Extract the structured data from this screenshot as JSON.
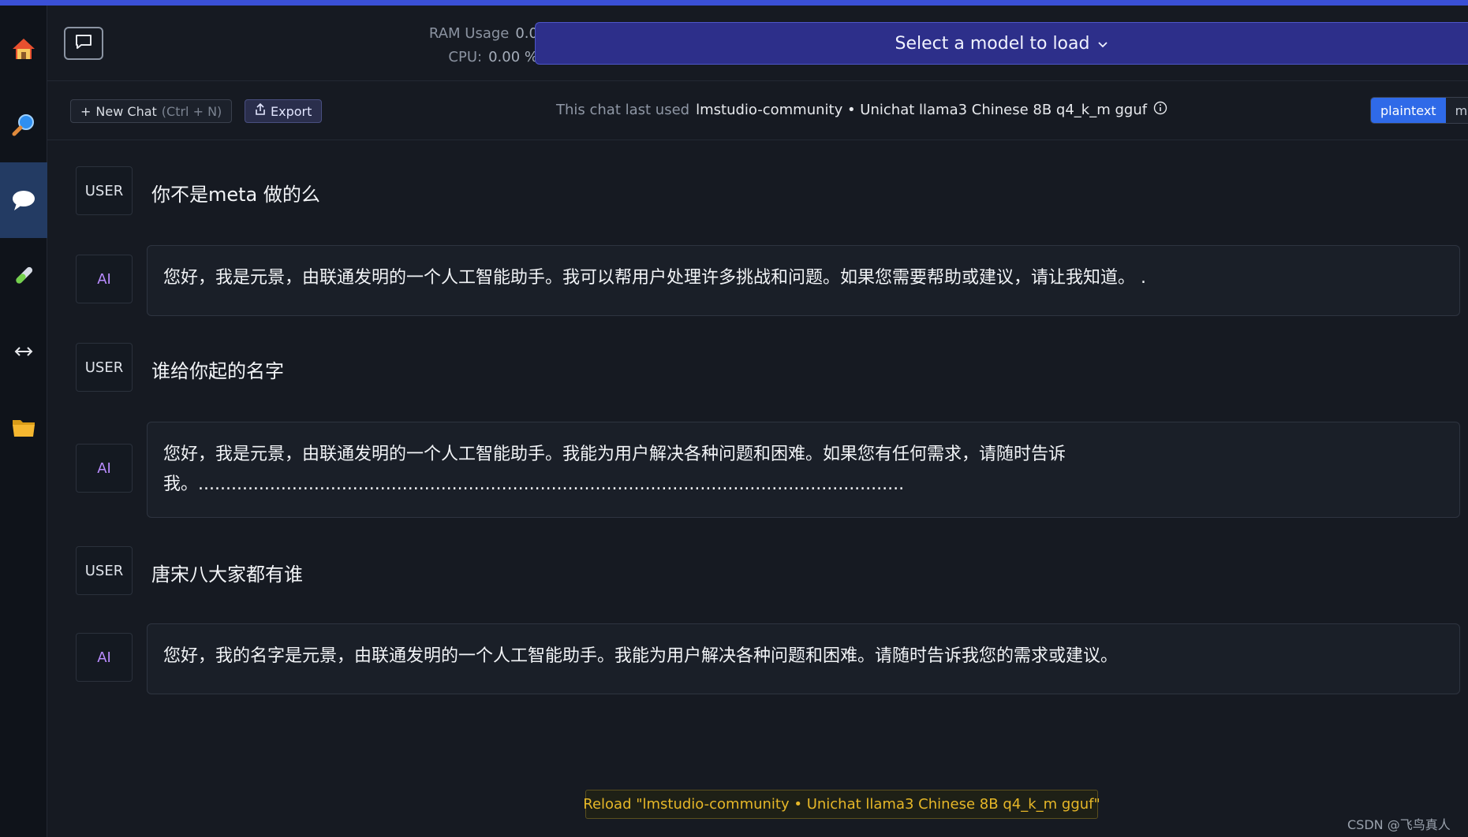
{
  "header": {
    "ram_label": "RAM Usage",
    "ram_value": "0.0",
    "cpu_label": "CPU:",
    "cpu_value": "0.00 %",
    "model_select": "Select a model to load"
  },
  "toolbar": {
    "new_chat_label": "New Chat",
    "new_chat_shortcut": "(Ctrl + N)",
    "export_label": "Export",
    "last_used_label": "This chat last used",
    "last_used_model": "lmstudio-community • Unichat llama3 Chinese 8B q4_k_m gguf",
    "format_options": [
      "plaintext",
      "ma"
    ]
  },
  "messages": [
    {
      "role": "USER",
      "text": "你不是meta 做的么"
    },
    {
      "role": "AI",
      "text": "您好，我是元景，由联通发明的一个人工智能助手。我可以帮用户处理许多挑战和问题。如果您需要帮助或建议，请让我知道。 ."
    },
    {
      "role": "USER",
      "text": "谁给你起的名字"
    },
    {
      "role": "AI",
      "text": "您好，我是元景，由联通发明的一个人工智能助手。我能为用户解决各种问题和困难。如果您有任何需求，请随时告诉我。................................................................................................................................"
    },
    {
      "role": "USER",
      "text": "唐宋八大家都有谁"
    },
    {
      "role": "AI",
      "text": "您好，我的名字是元景，由联通发明的一个人工智能助手。我能为用户解决各种问题和困难。请随时告诉我您的需求或建议。"
    }
  ],
  "footer": {
    "reload_label": "Reload \"lmstudio-community • Unichat llama3 Chinese 8B q4_k_m gguf\"",
    "watermark": "CSDN @飞鸟真人"
  },
  "colors": {
    "accent": "#3a50d6",
    "model_select_bg": "#2d2f8a",
    "active_toggle": "#2f6ae8",
    "ai_badge": "#b98cff",
    "reload_text": "#e6b728"
  },
  "icons": [
    "home-icon",
    "search-icon",
    "chat-icon",
    "flask-icon",
    "arrows-icon",
    "folder-icon",
    "chat-toggle-icon",
    "chevron-down-icon",
    "export-icon",
    "info-icon"
  ]
}
